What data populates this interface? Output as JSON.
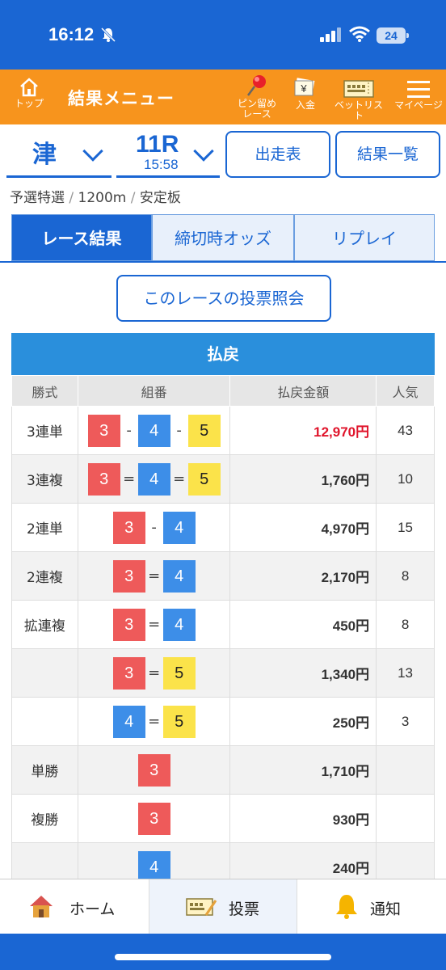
{
  "status_bar": {
    "time": "16:12",
    "battery": "24"
  },
  "menu": {
    "top_label": "トップ",
    "title": "結果メニュー",
    "pin_label_1": "ピン留め",
    "pin_label_2": "レース",
    "deposit_label": "入金",
    "betlist_label": "ベットリスト",
    "mypage_label": "マイページ"
  },
  "selectors": {
    "venue": "津",
    "race": "11R",
    "race_time": "15:58",
    "entries_button": "出走表",
    "results_button": "結果一覧"
  },
  "race_info": {
    "category": "予選特選",
    "distance": "1200m",
    "surface": "安定板"
  },
  "tabs": [
    "レース結果",
    "締切時オッズ",
    "リプレイ"
  ],
  "query_button": "このレースの投票照会",
  "payout": {
    "heading": "払戻",
    "headers": [
      "勝式",
      "組番",
      "払戻金額",
      "人気"
    ],
    "rows": [
      {
        "type": "3連単",
        "combo": [
          "3",
          "-",
          "4",
          "-",
          "5"
        ],
        "amount": "12,970円",
        "popularity": "43"
      },
      {
        "type": "3連複",
        "combo": [
          "3",
          "=",
          "4",
          "=",
          "5"
        ],
        "amount": "1,760円",
        "popularity": "10"
      },
      {
        "type": "2連単",
        "combo": [
          "3",
          "-",
          "4"
        ],
        "amount": "4,970円",
        "popularity": "15"
      },
      {
        "type": "2連複",
        "combo": [
          "3",
          "=",
          "4"
        ],
        "amount": "2,170円",
        "popularity": "8"
      },
      {
        "type": "拡連複",
        "combo": [
          "3",
          "=",
          "4"
        ],
        "amount": "450円",
        "popularity": "8"
      },
      {
        "type": "",
        "combo": [
          "3",
          "=",
          "5"
        ],
        "amount": "1,340円",
        "popularity": "13"
      },
      {
        "type": "",
        "combo": [
          "4",
          "=",
          "5"
        ],
        "amount": "250円",
        "popularity": "3"
      },
      {
        "type": "単勝",
        "combo": [
          "3"
        ],
        "amount": "1,710円",
        "popularity": ""
      },
      {
        "type": "複勝",
        "combo": [
          "3"
        ],
        "amount": "930円",
        "popularity": ""
      },
      {
        "type": "",
        "combo": [
          "4"
        ],
        "amount": "240円",
        "popularity": ""
      }
    ],
    "highlight_color": "#e0142b"
  },
  "bottom_nav": {
    "home": "ホーム",
    "vote": "投票",
    "notify": "通知"
  },
  "colors": {
    "primary": "#1a66d3",
    "menu_orange": "#f7941d",
    "payout_head": "#2a8fdc"
  }
}
